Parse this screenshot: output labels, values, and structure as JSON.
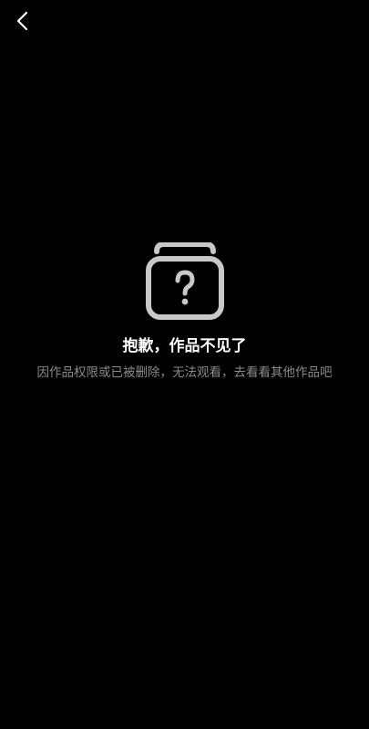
{
  "header": {
    "back_icon": "chevron-left-icon"
  },
  "empty_state": {
    "icon": "question-mark-stack-icon",
    "title": "抱歉，作品不见了",
    "description": "因作品权限或已被删除，无法观看，去看看其他作品吧"
  },
  "colors": {
    "background": "#000000",
    "title": "#ffffff",
    "description": "#8a8a8a",
    "icon": "#c8c8c8"
  }
}
